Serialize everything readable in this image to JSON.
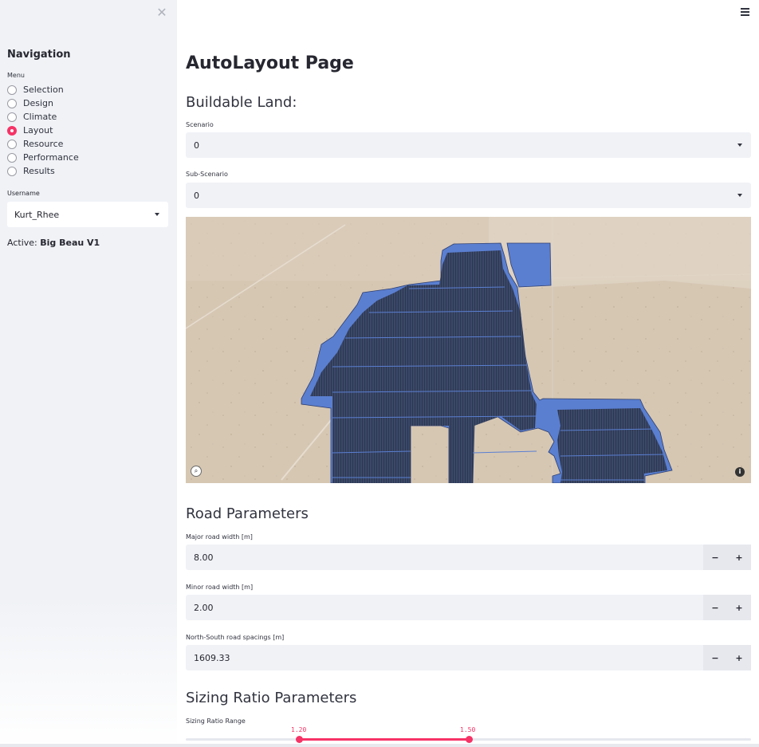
{
  "sidebar": {
    "close_glyph": "✕",
    "nav_title": "Navigation",
    "menu_label": "Menu",
    "menu_items": [
      "Selection",
      "Design",
      "Climate",
      "Layout",
      "Resource",
      "Performance",
      "Results"
    ],
    "selected": "Layout",
    "username_label": "Username",
    "username_value": "Kurt_Rhee",
    "active_prefix": "Active:",
    "active_value": "Big Beau V1"
  },
  "main": {
    "title": "AutoLayout Page",
    "buildable_header": "Buildable Land:",
    "scenario_label": "Scenario",
    "scenario_value": "0",
    "subscenario_label": "Sub-Scenario",
    "subscenario_value": "0",
    "map": {
      "info_icon": "info-icon",
      "search_icon": "search-icon"
    },
    "road_header": "Road Parameters",
    "major_label": "Major road width [m]",
    "major_value": "8.00",
    "minor_label": "Minor road width [m]",
    "minor_value": "2.00",
    "ns_label": "North-South road spacings [m]",
    "ns_value": "1609.33",
    "minus": "−",
    "plus": "+",
    "sizing_header": "Sizing Ratio Parameters",
    "sizing_label": "Sizing Ratio Range",
    "sizing_low": "1.20",
    "sizing_high": "1.50"
  },
  "colors": {
    "accent": "#f63366",
    "polygon": "#4a6fc9",
    "panel": "#3d4a6b"
  }
}
